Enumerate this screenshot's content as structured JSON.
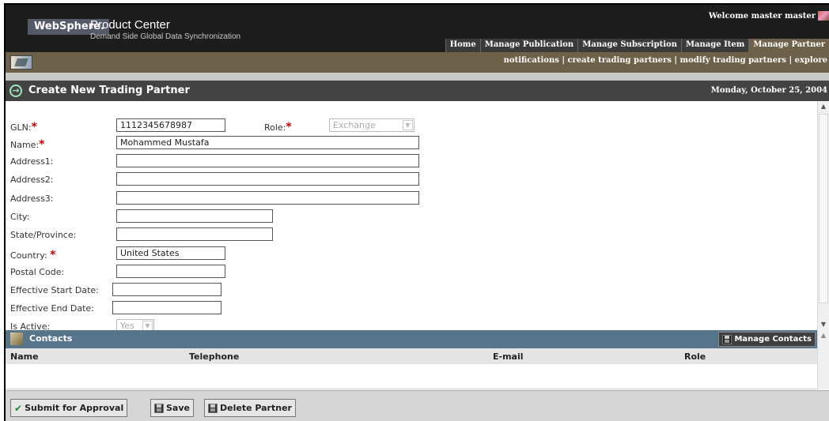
{
  "header": {
    "brand": "WebSphere.",
    "product": "Product Center",
    "subtitle": "Demand Side Global Data Synchronization",
    "welcome": "Welcome master master"
  },
  "tabs": [
    {
      "label": "Home"
    },
    {
      "label": "Manage Publication"
    },
    {
      "label": "Manage Subscription"
    },
    {
      "label": "Manage Item"
    },
    {
      "label": "Manage Partner",
      "active": true
    }
  ],
  "subnav": {
    "links": [
      "notifications",
      "create trading partners",
      "modify trading partners",
      "explore"
    ],
    "separator": " | "
  },
  "page": {
    "title": "Create New Trading Partner",
    "date": "Monday, October 25, 2004"
  },
  "form": {
    "gln": {
      "label": "GLN:",
      "value": "1112345678987"
    },
    "role": {
      "label": "Role:",
      "value": "Exchange"
    },
    "name": {
      "label": "Name:",
      "value": "Mohammed Mustafa"
    },
    "address1": {
      "label": "Address1:",
      "value": ""
    },
    "address2": {
      "label": "Address2:",
      "value": ""
    },
    "address3": {
      "label": "Address3:",
      "value": ""
    },
    "city": {
      "label": "City:",
      "value": ""
    },
    "state": {
      "label": "State/Province:",
      "value": ""
    },
    "country": {
      "label": "Country:",
      "value": "United States"
    },
    "postal": {
      "label": "Postal Code:",
      "value": ""
    },
    "start": {
      "label": "Effective Start Date:",
      "value": ""
    },
    "end": {
      "label": "Effective End Date:",
      "value": ""
    },
    "active": {
      "label": "Is Active:",
      "value": "Yes"
    },
    "required_mark": "*"
  },
  "contacts": {
    "title": "Contacts",
    "manage_label": "Manage Contacts",
    "columns": [
      "Name",
      "Telephone",
      "E-mail",
      "Role"
    ]
  },
  "actions": {
    "submit": "Submit for Approval",
    "save": "Save",
    "delete": "Delete Partner"
  }
}
